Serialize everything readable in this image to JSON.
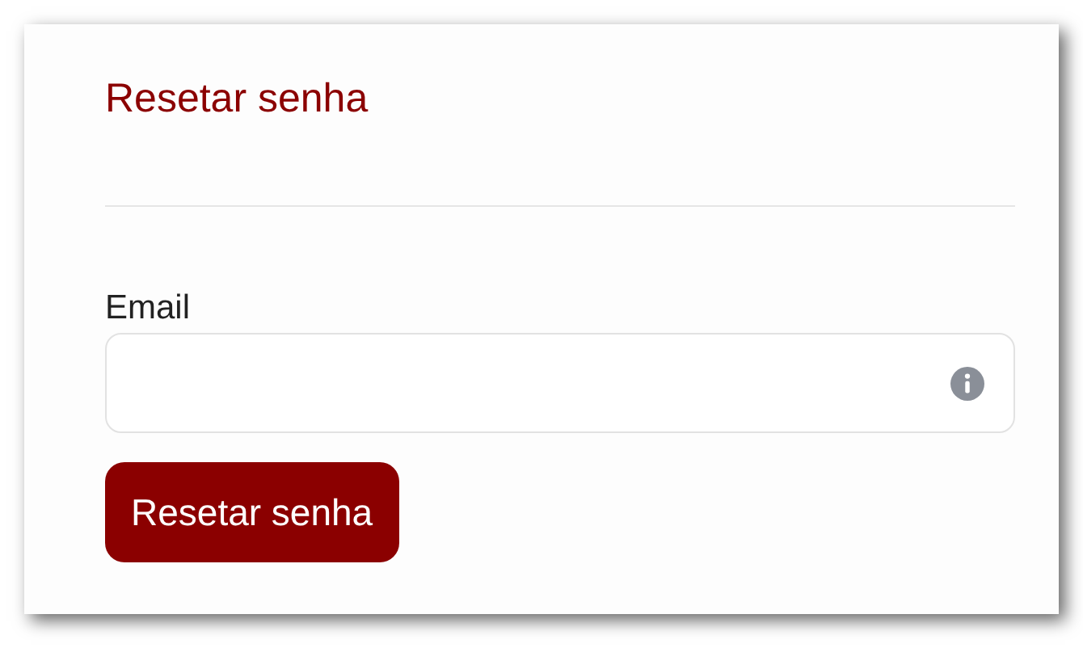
{
  "title": "Resetar senha",
  "email_field": {
    "label": "Email"
  },
  "submit_button": "Resetar senha"
}
